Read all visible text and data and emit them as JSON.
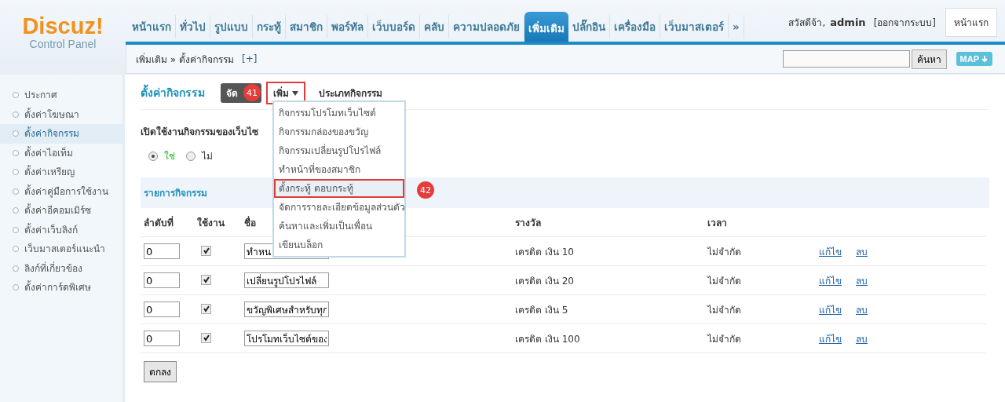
{
  "logo": {
    "brand": "Discuz!",
    "subtitle": "Control Panel"
  },
  "nav": [
    {
      "label": "หน้าแรก",
      "selected": false
    },
    {
      "label": "ทั่วไป",
      "selected": false
    },
    {
      "label": "รูปแบบ",
      "selected": false
    },
    {
      "label": "กระทู้",
      "selected": false
    },
    {
      "label": "สมาชิก",
      "selected": false
    },
    {
      "label": "พอร์ทัล",
      "selected": false
    },
    {
      "label": "เว็บบอร์ด",
      "selected": false
    },
    {
      "label": "คลับ",
      "selected": false
    },
    {
      "label": "ความปลอดภัย",
      "selected": false
    },
    {
      "label": "เพิ่มเติม",
      "selected": true
    },
    {
      "label": "ปลั๊กอิน",
      "selected": false
    },
    {
      "label": "เครื่องมือ",
      "selected": false
    },
    {
      "label": "เว็บมาสเตอร์",
      "selected": false
    },
    {
      "label": "»",
      "selected": false
    }
  ],
  "user": {
    "greeting": "สวัสดีจ้า,",
    "name": "admin",
    "logout": "[ออกจากระบบ]",
    "home_button": "หน้าแรก"
  },
  "breadcrumb": {
    "text": "เพิ่มเติม » ตั้งค่ากิจกรรม",
    "add": "[+]"
  },
  "search": {
    "button": "ค้นหา",
    "map": "MAP"
  },
  "sidebar": [
    {
      "label": "ประกาศ",
      "selected": false
    },
    {
      "label": "ตั้งค่าโฆษณา",
      "selected": false
    },
    {
      "label": "ตั้งค่ากิจกรรม",
      "selected": true
    },
    {
      "label": "ตั้งค่าไอเท็ม",
      "selected": false
    },
    {
      "label": "ตั้งค่าเหรียญ",
      "selected": false
    },
    {
      "label": "ตั้งค่าคู่มือการใช้งาน",
      "selected": false
    },
    {
      "label": "ตั้งค่าอีคอมเมิร์ซ",
      "selected": false
    },
    {
      "label": "ตั้งค่าเว็บลิงก์",
      "selected": false
    },
    {
      "label": "เว็บมาสเตอร์แนะนำ",
      "selected": false
    },
    {
      "label": "ลิงก์ที่เกี่ยวข้อง",
      "selected": false
    },
    {
      "label": "ตั้งค่าการ์ดพิเศษ",
      "selected": false
    }
  ],
  "page": {
    "title": "ตั้งค่ากิจกรรม",
    "tabs": [
      {
        "label": "จัด",
        "selected": true
      },
      {
        "label": "เพิ่ม",
        "selected": false
      },
      {
        "label": "ประเภทกิจกรรม",
        "selected": false
      }
    ]
  },
  "markers": [
    {
      "label": "41"
    },
    {
      "label": "42"
    }
  ],
  "dropdown": [
    {
      "label": "กิจกรรมโปรโมทเว็บไซต์",
      "selected": false
    },
    {
      "label": "กิจกรรมกล่องของขวัญ",
      "selected": false
    },
    {
      "label": "กิจกรรมเปลี่ยนรูปโปรไฟล์",
      "selected": false
    },
    {
      "label": "ทำหน้าที่ของสมาชิก",
      "selected": false
    },
    {
      "label": "ตั้งกระทู้ ตอบกระทู้",
      "selected": true
    },
    {
      "label": "จัดการรายละเอียดข้อมูลส่วนตัว",
      "selected": false
    },
    {
      "label": "ค้นหาและเพิ่มเป็นเพื่อน",
      "selected": false
    },
    {
      "label": "เขียนบล็อก",
      "selected": false
    }
  ],
  "enable": {
    "label": "เปิดใช้งานกิจกรรมของเว็บไซ",
    "options": [
      {
        "label": "ใช่",
        "selected": true
      },
      {
        "label": "ไม่",
        "selected": false
      }
    ]
  },
  "list": {
    "title": "รายการกิจกรรม",
    "columns": [
      "ลำดับที่",
      "ใช้งาน",
      "ชื่อ",
      "รางวัล",
      "เวลา"
    ],
    "rows": [
      {
        "order": "0",
        "checked": true,
        "name": "ทำหน",
        "reward": "เครดิต เงิน 10",
        "time": "ไม่จำกัด",
        "edit": "แก้ไข",
        "delete": "ลบ"
      },
      {
        "order": "0",
        "checked": true,
        "name": "เปลี่ยนรูปโปรไฟล์",
        "reward": "เครดิต เงิน 20",
        "time": "ไม่จำกัด",
        "edit": "แก้ไข",
        "delete": "ลบ"
      },
      {
        "order": "0",
        "checked": true,
        "name": "ขวัญพิเศษสำหรับทุก",
        "reward": "เครดิต เงิน 5",
        "time": "ไม่จำกัด",
        "edit": "แก้ไข",
        "delete": "ลบ"
      },
      {
        "order": "0",
        "checked": true,
        "name": "โปรโมทเว็บไซต์ของ",
        "reward": "เครดิต เงิน 100",
        "time": "ไม่จำกัด",
        "edit": "แก้ไข",
        "delete": "ลบ"
      }
    ],
    "submit": "ตกลง"
  }
}
